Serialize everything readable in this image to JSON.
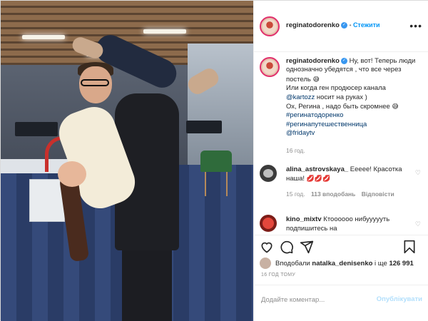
{
  "post": {
    "author": "reginatodorenko",
    "follow_label": "Стежити",
    "more_label": "•••"
  },
  "caption": {
    "author": "reginatodorenko",
    "line1": "Ну, вот! Теперь люди однозначно убедятся , что все через постель",
    "emoji1": "😅",
    "line2": "Или когда ген продюсер канала",
    "mention1": "@kartozz",
    "line3": " носит на руках )",
    "line4": "Ох, Регина , надо быть скромнее",
    "emoji2": "😅",
    "hashtag1": "#регинатодоренко",
    "hashtag2": "#регинапутешественница",
    "mention2": "@fridaytv",
    "time": "16 год."
  },
  "comments": [
    {
      "author": "alina_astrovskaya_",
      "text": "Еееее! Красотка наша!",
      "emojis": "💋💋💋",
      "time": "15 год.",
      "likes": "113 вподобань",
      "reply": "Відповісти"
    },
    {
      "author": "kino_mixtv",
      "text": "Ктоооооо нибуууууть подпишитесь на"
    }
  ],
  "likes": {
    "prefix": "Вподобали",
    "user": "natalka_denisenko",
    "middle": "і ще",
    "count": "126 991"
  },
  "timestamp": "16 ГОД ТОМУ",
  "comment_box": {
    "placeholder": "Додайте коментар...",
    "publish_label": "Опублікувати"
  },
  "icons": {
    "like": "heart-icon",
    "comment": "comment-icon",
    "share": "share-icon",
    "save": "bookmark-icon",
    "verified": "verified-badge-icon"
  },
  "colors": {
    "link": "#0095f6",
    "tag": "#00376b",
    "muted": "#8e8e8e",
    "verified": "#3897f0"
  }
}
